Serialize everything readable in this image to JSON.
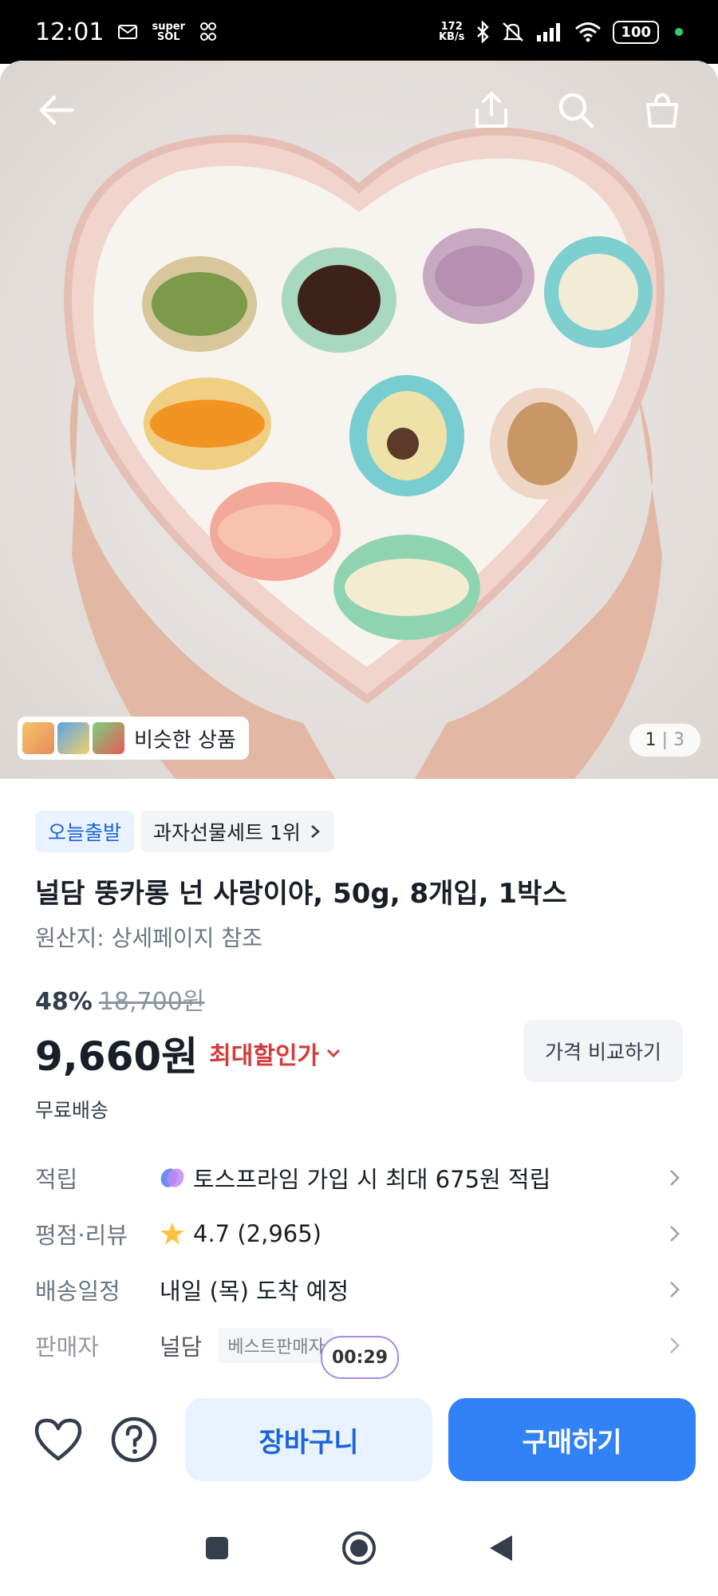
{
  "status_bar": {
    "time": "12:01",
    "super_label": "super",
    "net_speed_value": "172",
    "net_speed_unit": "KB/s",
    "battery": "100"
  },
  "hero": {
    "similar_label": "비슷한 상품",
    "pager_current": "1",
    "pager_sep": "|",
    "pager_total": "3"
  },
  "product": {
    "badge_today": "오늘출발",
    "badge_rank": "과자선물세트 1위",
    "title": "널담 뚱카롱 넌 사랑이야, 50g, 8개입, 1박스",
    "origin": "원산지: 상세페이지 참조",
    "discount_rate": "48%",
    "original_price": "18,700원",
    "price": "9,660원",
    "max_discount_label": "최대할인가",
    "compare_label": "가격 비교하기",
    "shipping": "무료배송"
  },
  "info_rows": {
    "points_label": "적립",
    "points_value": "토스프라임 가입 시 최대 675원 적립",
    "rating_label": "평점·리뷰",
    "rating_value": "4.7 (2,965)",
    "delivery_label": "배송일정",
    "delivery_value": "내일 (목) 도착 예정",
    "seller_label": "판매자",
    "seller_value": "널담",
    "seller_badge": "베스트판매자"
  },
  "timer": "00:29",
  "actions": {
    "cart_label": "장바구니",
    "buy_label": "구매하기"
  },
  "colors": {
    "accent": "#3182f6",
    "accent_light": "#e8f3ff",
    "discount_red": "#d63a3a",
    "star": "#ffc342"
  },
  "icons": [
    "back-arrow-icon",
    "share-icon",
    "search-icon",
    "bag-icon",
    "chevron-right-icon",
    "chevron-down-icon",
    "star-icon",
    "heart-icon",
    "help-icon",
    "toss-prime-icon"
  ]
}
